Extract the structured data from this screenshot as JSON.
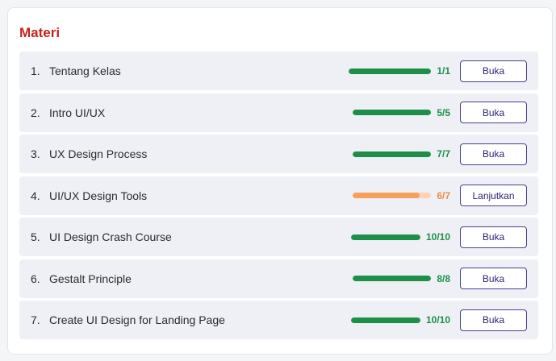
{
  "section": {
    "title": "Materi"
  },
  "colors": {
    "title": "#c3261f",
    "complete": "#1d8f49",
    "in_progress": "#f7a05a",
    "button_border": "#4a3d94"
  },
  "modules": [
    {
      "number": "1.",
      "title": "Tentang Kelas",
      "done": 1,
      "total": 1,
      "progress_text": "1/1",
      "status": "complete",
      "action": "Buka"
    },
    {
      "number": "2.",
      "title": "Intro UI/UX",
      "done": 5,
      "total": 5,
      "progress_text": "5/5",
      "status": "complete",
      "action": "Buka"
    },
    {
      "number": "3.",
      "title": "UX Design Process",
      "done": 7,
      "total": 7,
      "progress_text": "7/7",
      "status": "complete",
      "action": "Buka"
    },
    {
      "number": "4.",
      "title": "UI/UX Design Tools",
      "done": 6,
      "total": 7,
      "progress_text": "6/7",
      "status": "in_progress",
      "action": "Lanjutkan"
    },
    {
      "number": "5.",
      "title": "UI Design Crash Course",
      "done": 10,
      "total": 10,
      "progress_text": "10/10",
      "status": "complete",
      "action": "Buka"
    },
    {
      "number": "6.",
      "title": "Gestalt Principle",
      "done": 8,
      "total": 8,
      "progress_text": "8/8",
      "status": "complete",
      "action": "Buka"
    },
    {
      "number": "7.",
      "title": "Create UI Design for Landing Page",
      "done": 10,
      "total": 10,
      "progress_text": "10/10",
      "status": "complete",
      "action": "Buka"
    }
  ]
}
